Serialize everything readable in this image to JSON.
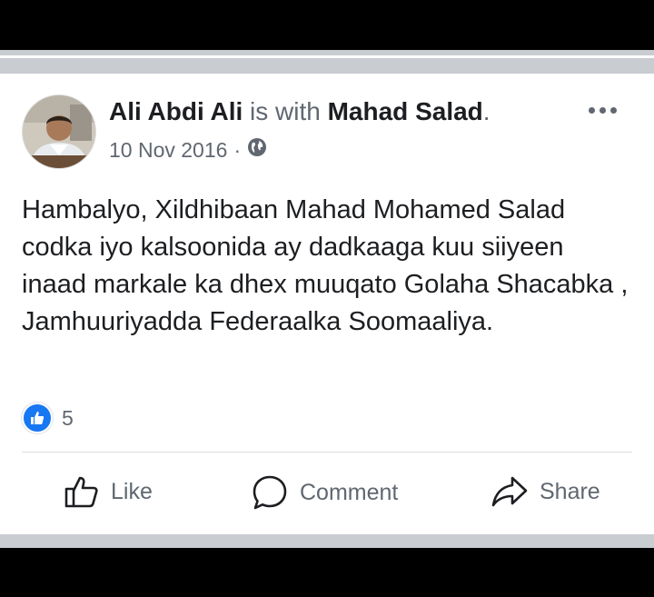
{
  "post": {
    "author": "Ali Abdi Ali",
    "with_text": "is with",
    "tagged": "Mahad Salad",
    "period": ".",
    "date": "10 Nov 2016",
    "separator": "·",
    "privacy_icon": "globe-icon",
    "text": "Hambalyo, Xildhibaan Mahad Mohamed Salad codka iyo kalsoonida ay dadkaaga kuu siiyeen inaad markale ka dhex muuqato Golaha Shacabka , Jamhuuriyadda Federaalka Soomaaliya.",
    "reaction_count": "5"
  },
  "actions": {
    "like": "Like",
    "comment": "Comment",
    "share": "Share"
  },
  "colors": {
    "accent": "#1877f2",
    "text_primary": "#1c1e21",
    "text_secondary": "#606770"
  }
}
